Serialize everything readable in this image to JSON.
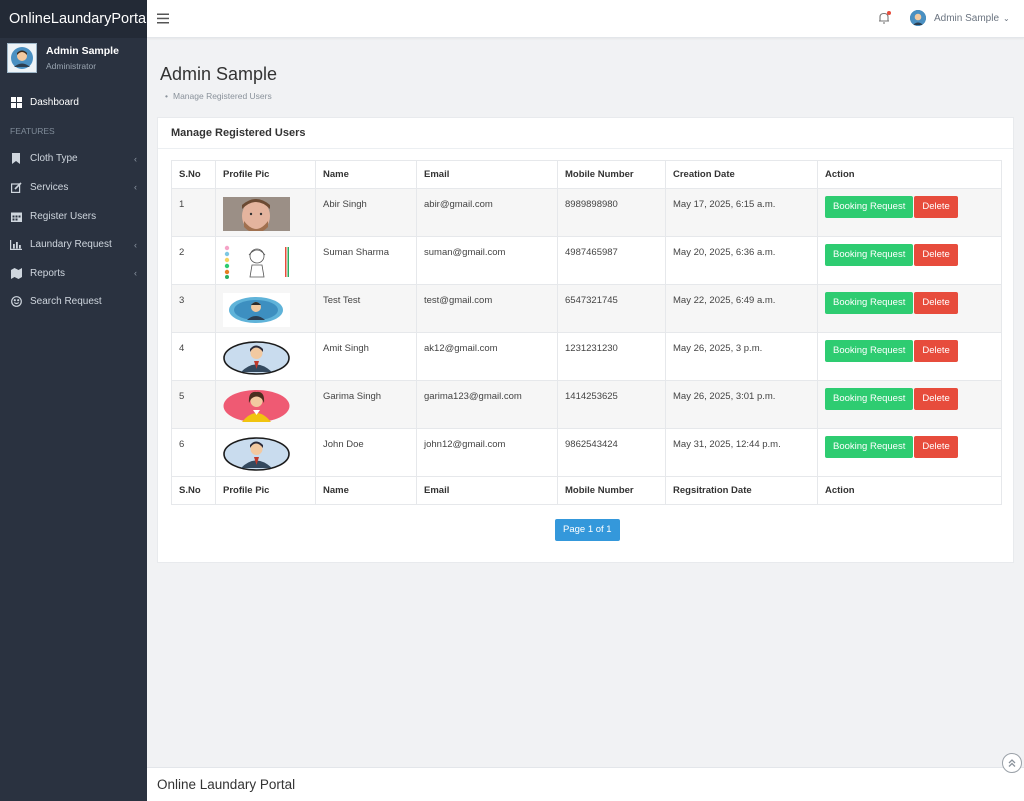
{
  "brand": "OnlineLaundaryPortal",
  "profile": {
    "name": "Admin Sample",
    "role": "Administrator"
  },
  "nav": {
    "dashboard": "Dashboard",
    "section": "FEATURES",
    "items": [
      {
        "label": "Cloth Type",
        "icon": "bookmark-icon",
        "caret": "‹"
      },
      {
        "label": "Services",
        "icon": "edit-icon",
        "caret": "‹"
      },
      {
        "label": "Register Users",
        "icon": "calendar-icon",
        "caret": ""
      },
      {
        "label": "Laundary Request",
        "icon": "bar-chart-icon",
        "caret": "‹"
      },
      {
        "label": "Reports",
        "icon": "map-icon",
        "caret": "‹"
      },
      {
        "label": "Search Request",
        "icon": "smile-icon",
        "caret": ""
      }
    ]
  },
  "header": {
    "user": "Admin Sample"
  },
  "page": {
    "title": "Admin Sample",
    "breadcrumb": "Manage Registered Users"
  },
  "card": {
    "title": "Manage Registered Users"
  },
  "table": {
    "headers": [
      "S.No",
      "Profile Pic",
      "Name",
      "Email",
      "Mobile Number",
      "Creation Date",
      "Action"
    ],
    "footer_headers": [
      "S.No",
      "Profile Pic",
      "Name",
      "Email",
      "Mobile Number",
      "Regsitration Date",
      "Action"
    ],
    "rows": [
      {
        "sno": "1",
        "pic": "photo-man",
        "name": "Abir Singh",
        "email": "abir@gmail.com",
        "mobile": "8989898980",
        "date": "May 17, 2025, 6:15 a.m."
      },
      {
        "sno": "2",
        "pic": "girl-drawing",
        "name": "Suman Sharma",
        "email": "suman@gmail.com",
        "mobile": "4987465987",
        "date": "May 20, 2025, 6:36 a.m."
      },
      {
        "sno": "3",
        "pic": "avatar-blue",
        "name": "Test Test",
        "email": "test@gmail.com",
        "mobile": "6547321745",
        "date": "May 22, 2025, 6:49 a.m."
      },
      {
        "sno": "4",
        "pic": "avatar-man-suit",
        "name": "Amit Singh",
        "email": "ak12@gmail.com",
        "mobile": "1231231230",
        "date": "May 26, 2025, 3 p.m."
      },
      {
        "sno": "5",
        "pic": "avatar-woman",
        "name": "Garima Singh",
        "email": "garima123@gmail.com",
        "mobile": "1414253625",
        "date": "May 26, 2025, 3:01 p.m."
      },
      {
        "sno": "6",
        "pic": "avatar-man-suit",
        "name": "John Doe",
        "email": "john12@gmail.com",
        "mobile": "9862543424",
        "date": "May 31, 2025, 12:44 p.m."
      }
    ],
    "actions": {
      "booking": "Booking Request",
      "delete": "Delete"
    }
  },
  "pager": "Page 1 of 1",
  "footer": "Online Laundary Portal",
  "colors": {
    "sidebar": "#2a3240",
    "green": "#2ecc71",
    "red": "#e74c3c",
    "blue": "#3498db"
  }
}
